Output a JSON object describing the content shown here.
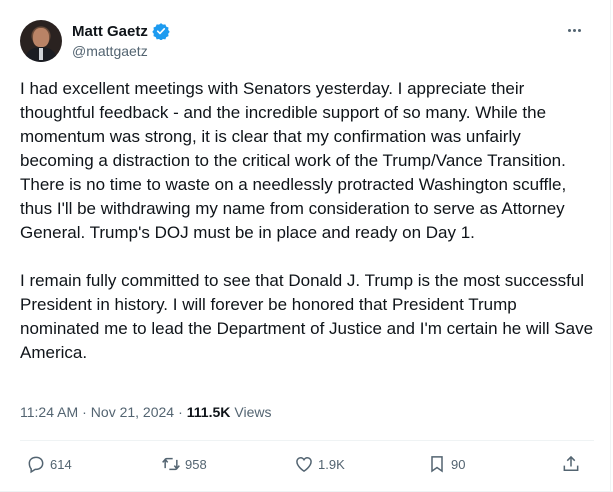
{
  "author": {
    "display_name": "Matt Gaetz",
    "handle": "@mattgaetz",
    "verified": true
  },
  "tweet": {
    "paragraphs": [
      "I had excellent meetings with Senators yesterday.  I appreciate their thoughtful feedback - and the incredible support of so many.  While the momentum was strong, it is clear that my confirmation was unfairly becoming a distraction to the critical work of the Trump/Vance Transition.  There is no time to waste on a needlessly protracted Washington scuffle, thus I'll be withdrawing my name from consideration to serve as Attorney General.  Trump's DOJ must be in place and ready on Day 1.",
      "I remain fully committed to see that Donald J. Trump is the most successful President in history.  I will forever be honored that President Trump nominated me to lead the Department of Justice and I'm certain he will Save America."
    ],
    "time": "11:24 AM",
    "separator1": "·",
    "date": "Nov 21, 2024",
    "separator2": "·",
    "views_count": "111.5K",
    "views_label": "Views"
  },
  "actions": {
    "replies": "614",
    "reposts": "958",
    "likes": "1.9K",
    "bookmarks": "90"
  },
  "colors": {
    "text": "#0f1419",
    "secondary": "#536471",
    "verified_badge": "#1d9bf0",
    "divider": "#eff3f4"
  },
  "icons": [
    "more-icon",
    "verified-badge-icon",
    "reply-icon",
    "repost-icon",
    "like-icon",
    "bookmark-icon",
    "share-icon"
  ]
}
